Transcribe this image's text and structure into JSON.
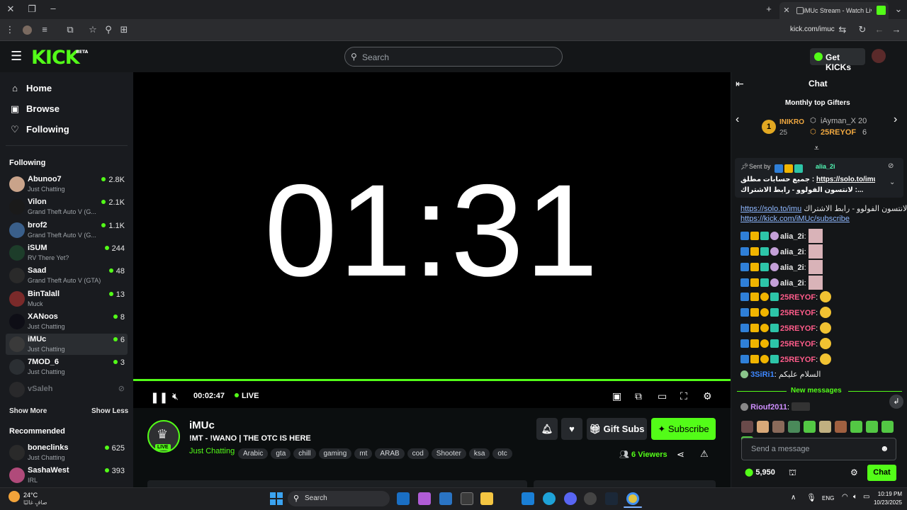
{
  "browser": {
    "tab_title": "iMUc Stream - Watch Live o",
    "url": "kick.com/imuc"
  },
  "header": {
    "logo": "KICK",
    "logo_beta": "BETA",
    "search_placeholder": "Search",
    "get_kicks": "Get KICKs"
  },
  "sidebar": {
    "nav": [
      {
        "label": "Home",
        "icon": "home-icon"
      },
      {
        "label": "Browse",
        "icon": "browse-icon"
      },
      {
        "label": "Following",
        "icon": "heart-icon"
      }
    ],
    "following_title": "Following",
    "following": [
      {
        "name": "Abunoo7",
        "category": "Just Chatting",
        "viewers": "2.8K",
        "color": "#c9a38a"
      },
      {
        "name": "Vilon",
        "category": "Grand Theft Auto V (G...",
        "viewers": "2.1K",
        "color": "#1a1a1a"
      },
      {
        "name": "brof2",
        "category": "Grand Theft Auto V (G...",
        "viewers": "1.1K",
        "color": "#3a5f8a"
      },
      {
        "name": "iSUM",
        "category": "RV There Yet?",
        "viewers": "244",
        "color": "#1d3d2a"
      },
      {
        "name": "Saad",
        "category": "Grand Theft Auto V (GTA)",
        "viewers": "48",
        "color": "#2a2a2a"
      },
      {
        "name": "BinTalall",
        "category": "Muck",
        "viewers": "13",
        "color": "#7a2a2a"
      },
      {
        "name": "XANoos",
        "category": "Just Chatting",
        "viewers": "8",
        "color": "#0e0e16"
      },
      {
        "name": "iMUc",
        "category": "Just Chatting",
        "viewers": "6",
        "color": "#3a3a3a"
      },
      {
        "name": "7MOD_6",
        "category": "Just Chatting",
        "viewers": "3",
        "color": "#2b2f33"
      }
    ],
    "offline_channel": "vSaleh",
    "show_more": "Show More",
    "show_less": "Show Less",
    "recommended_title": "Recommended",
    "recommended": [
      {
        "name": "boneclinks",
        "category": "Just Chatting",
        "viewers": "625",
        "color": "#2a2a2a"
      },
      {
        "name": "SashaWest",
        "category": "IRL",
        "viewers": "393",
        "color": "#b04a7a"
      }
    ]
  },
  "player": {
    "overlay_time": "01:31",
    "elapsed": "00:02:47",
    "live_label": "LIVE"
  },
  "stream": {
    "channel": "iMUc",
    "avatar_live": "LIVE",
    "title": "!MT - !WANO | THE OTC IS HERE",
    "category": "Just Chatting",
    "tags": [
      "Arabic",
      "gta",
      "chill",
      "gaming",
      "mt",
      "ARAB",
      "cod",
      "Shooter",
      "ksa",
      "otc"
    ],
    "gift_subs": "Gift Subs",
    "subscribe": "Subscribe",
    "viewers": "6 Viewers"
  },
  "chat": {
    "title": "Chat",
    "gifters_title": "Monthly top Gifters",
    "gifters": [
      {
        "rank": "1",
        "name": "INIKRO",
        "count": "25"
      },
      {
        "name": "iAyman_X",
        "count": "20"
      },
      {
        "name": "25REYOF",
        "count": "6"
      }
    ],
    "pinned_by_label": "Sent by",
    "pinned_user": "alia_2i",
    "pinned_line1_text": "جميع حسابات مطلق : ",
    "pinned_line1_link": "https://solo.to/imu",
    "pinned_line2": "لانتسون الفولوو - رابط الاشتراك :...",
    "links": {
      "solo": "https://solo.to/imu",
      "solo_suffix": " لانتسون الفولوو - رابط الاشتراك :",
      "kick_sub": "https://kick.com/iMUc/subscribe"
    },
    "messages": [
      {
        "user": "alia_2i",
        "color": "#e8e8e8"
      },
      {
        "user": "alia_2i",
        "color": "#e8e8e8"
      },
      {
        "user": "alia_2i",
        "color": "#e8e8e8"
      },
      {
        "user": "alia_2i",
        "color": "#e8e8e8"
      },
      {
        "user": "25REYOF",
        "color": "#ff5c8a"
      },
      {
        "user": "25REYOF",
        "color": "#ff5c8a"
      },
      {
        "user": "25REYOF",
        "color": "#ff5c8a"
      },
      {
        "user": "25REYOF",
        "color": "#ff5c8a"
      },
      {
        "user": "25REYOF",
        "color": "#ff5c8a"
      }
    ],
    "salam_user": "3SiRi1",
    "salam_text": "السلام عليكم",
    "new_messages": "New messages",
    "last_user": "Riouf2011",
    "input_placeholder": "Send a message",
    "points": "5,950",
    "send": "Chat"
  },
  "taskbar": {
    "weather_temp": "24°C",
    "weather_desc": "صافٍ غالبًا",
    "search": "Search",
    "lang": "ENG",
    "time": "10:19 PM",
    "date": "10/23/2025"
  },
  "colors": {
    "accent": "#53fc18",
    "bg": "#0b0e0f",
    "sidebar": "#191b1f"
  }
}
